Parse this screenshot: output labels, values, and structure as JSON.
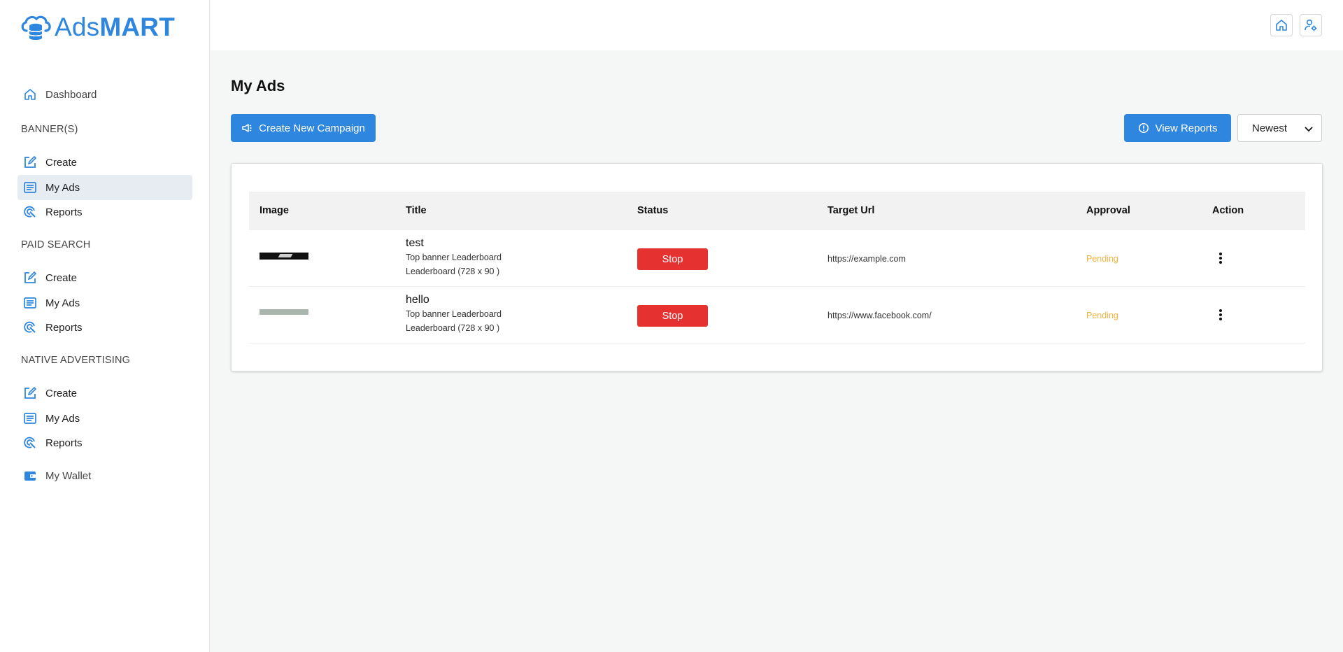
{
  "logo": {
    "prefix": "Ads",
    "suffix": "MART"
  },
  "sidebar": {
    "dashboard": "Dashboard",
    "sections": [
      {
        "title": "BANNER(S)",
        "items": [
          "Create",
          "My Ads",
          "Reports"
        ]
      },
      {
        "title": "PAID SEARCH",
        "items": [
          "Create",
          "My Ads",
          "Reports"
        ]
      },
      {
        "title": "NATIVE ADVERTISING",
        "items": [
          "Create",
          "My Ads",
          "Reports"
        ]
      }
    ],
    "wallet": "My Wallet",
    "active": "BANNER(S) / My Ads"
  },
  "main": {
    "title": "My Ads",
    "create_button": "Create New Campaign",
    "reports_button": "View Reports",
    "sort_value": "Newest"
  },
  "table": {
    "headers": [
      "Image",
      "Title",
      "Status",
      "Target Url",
      "Approval",
      "Action"
    ],
    "rows": [
      {
        "title": "test",
        "sub1": "Top banner Leaderboard",
        "sub2": "Leaderboard (728 x 90 )",
        "status": "Stop",
        "url": "https://example.com",
        "approval": "Pending"
      },
      {
        "title": "hello",
        "sub1": "Top banner Leaderboard",
        "sub2": "Leaderboard (728 x 90 )",
        "status": "Stop",
        "url": "https://www.facebook.com/",
        "approval": "Pending"
      }
    ]
  },
  "colors": {
    "accent": "#2e86de",
    "stop": "#e53130",
    "pending": "#f2b43a"
  }
}
